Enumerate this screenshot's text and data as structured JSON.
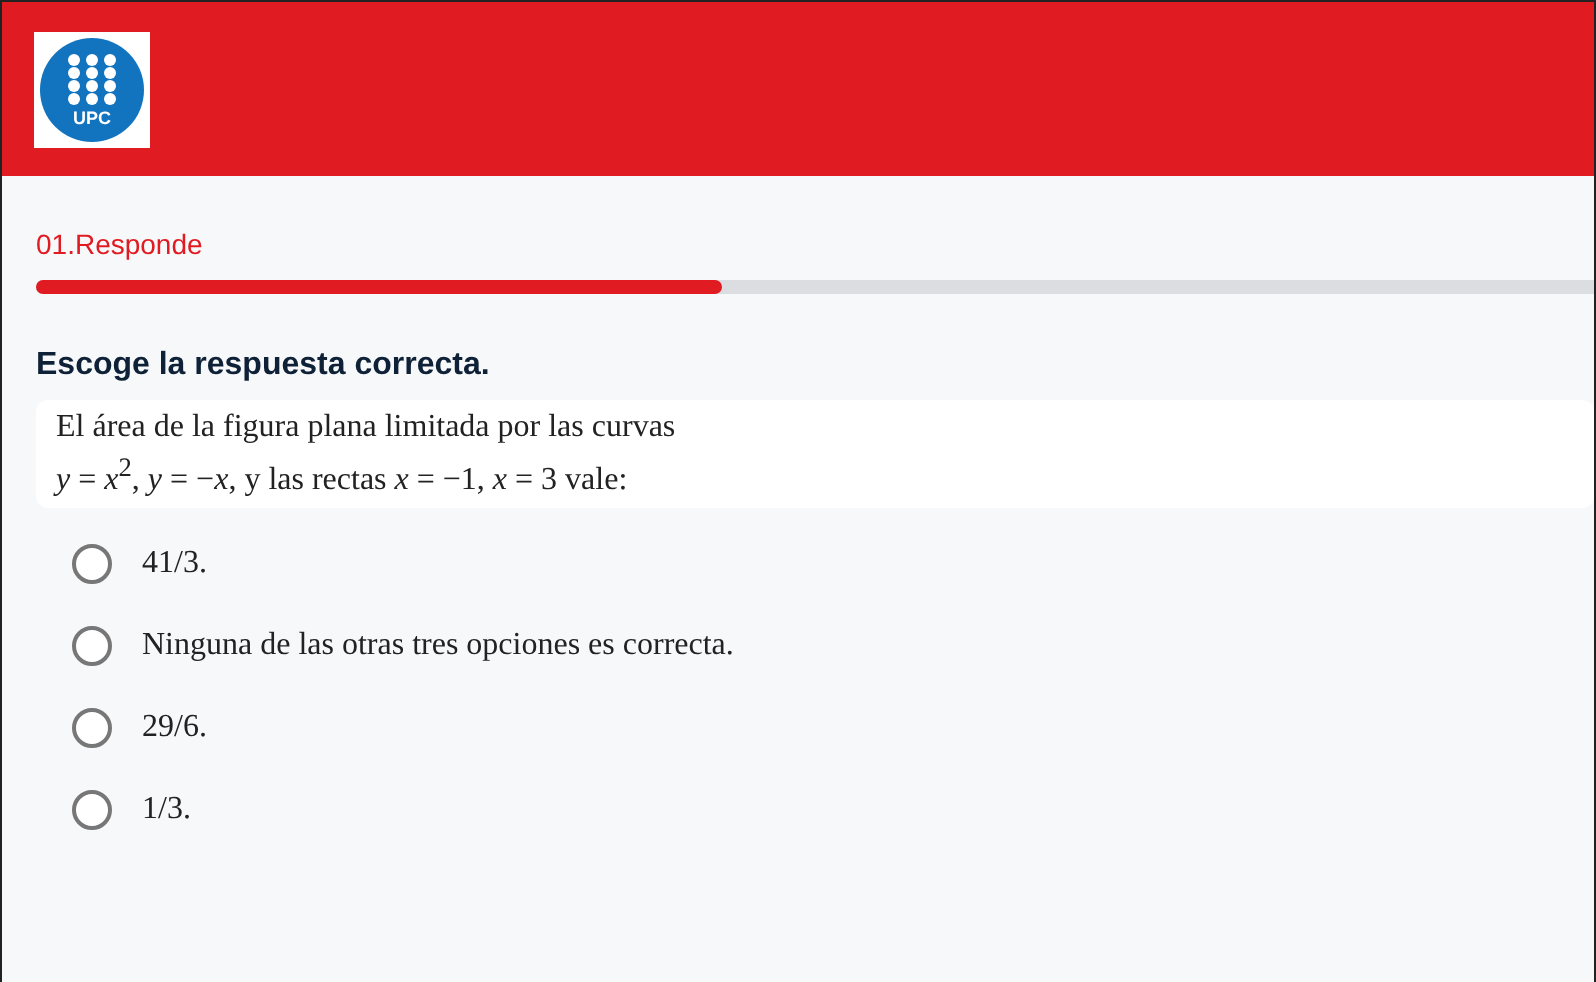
{
  "header": {
    "logo_text": "UPC"
  },
  "section": {
    "title": "01.Responde",
    "progress": {
      "level": 0.44
    }
  },
  "question": {
    "instruction": "Escoge la respuesta correcta.",
    "statement_lines": [
      "El área de la figura plana limitada por las curvas",
      "*y* = *x*$^{2}$,  *y* = −*x*,  y las rectas  *x* = −1,  *x* = 3  vale:"
    ]
  },
  "options": [
    {
      "label": "41/3.",
      "selected": false
    },
    {
      "label": "Ninguna de las otras tres opciones es correcta.",
      "selected": false
    },
    {
      "label": "29/6.",
      "selected": false
    },
    {
      "label": "1/3.",
      "selected": false
    }
  ]
}
